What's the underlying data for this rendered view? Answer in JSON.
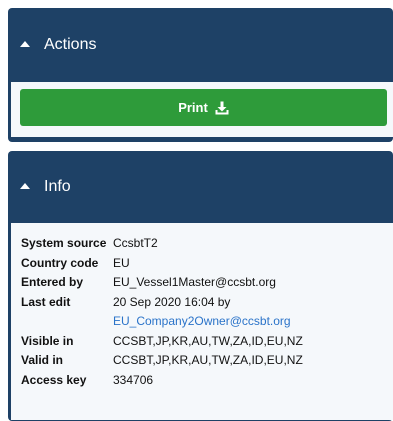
{
  "actions": {
    "title": "Actions",
    "print_label": "Print",
    "button_color": "#2e9b3a"
  },
  "info": {
    "title": "Info",
    "system_source_label": "System source",
    "system_source_value": "CcsbtT2",
    "country_code_label": "Country code",
    "country_code_value": "EU",
    "entered_by_label": "Entered by",
    "entered_by_value": "EU_Vessel1Master@ccsbt.org",
    "last_edit_label": "Last edit",
    "last_edit_value": "20 Sep 2020 16:04 by",
    "last_edit_user": "EU_Company2Owner@ccsbt.org",
    "visible_in_label": "Visible in",
    "visible_in_value": "CCSBT,JP,KR,AU,TW,ZA,ID,EU,NZ",
    "valid_in_label": "Valid in",
    "valid_in_value": "CCSBT,JP,KR,AU,TW,ZA,ID,EU,NZ",
    "access_key_label": "Access key",
    "access_key_value": "334706"
  },
  "colors": {
    "panel_header": "#1e4166",
    "panel_body": "#f5f8fb",
    "link": "#2a73c9"
  },
  "icons": {
    "collapse": "caret-up-icon",
    "download": "download-icon"
  }
}
